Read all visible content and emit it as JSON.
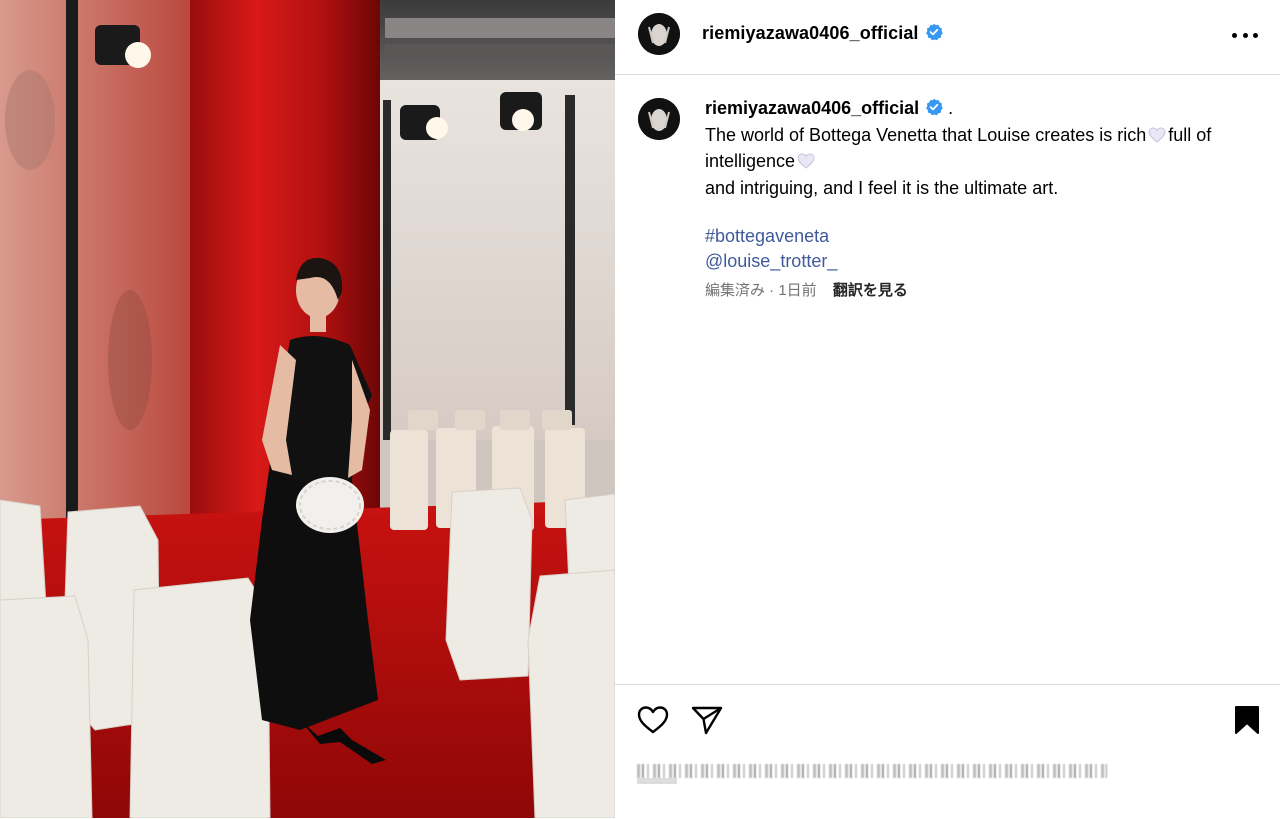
{
  "post": {
    "username": "riemiyazawa0406_official",
    "caption_lines": [
      "The world of Bottega Venetta that Louise creates is rich",
      "full of",
      "intelligence",
      "and intriguing, and I feel it is the ultimate art."
    ],
    "hashtag": "#bottegaveneta",
    "mention": "@louise_trotter_",
    "edited_time": "編集済み · 1日前",
    "translate_label": "翻訳を見る"
  },
  "icons": {
    "verified": "verified-badge-icon",
    "more": "more-options-icon",
    "like": "heart-icon",
    "share": "paper-plane-icon",
    "save": "bookmark-icon",
    "emoji": "white-heart-emoji"
  },
  "colors": {
    "verified_blue": "#3897f0",
    "link_blue": "#3f5a9a",
    "meta_gray": "#737373",
    "divider": "#dbdbdb"
  }
}
